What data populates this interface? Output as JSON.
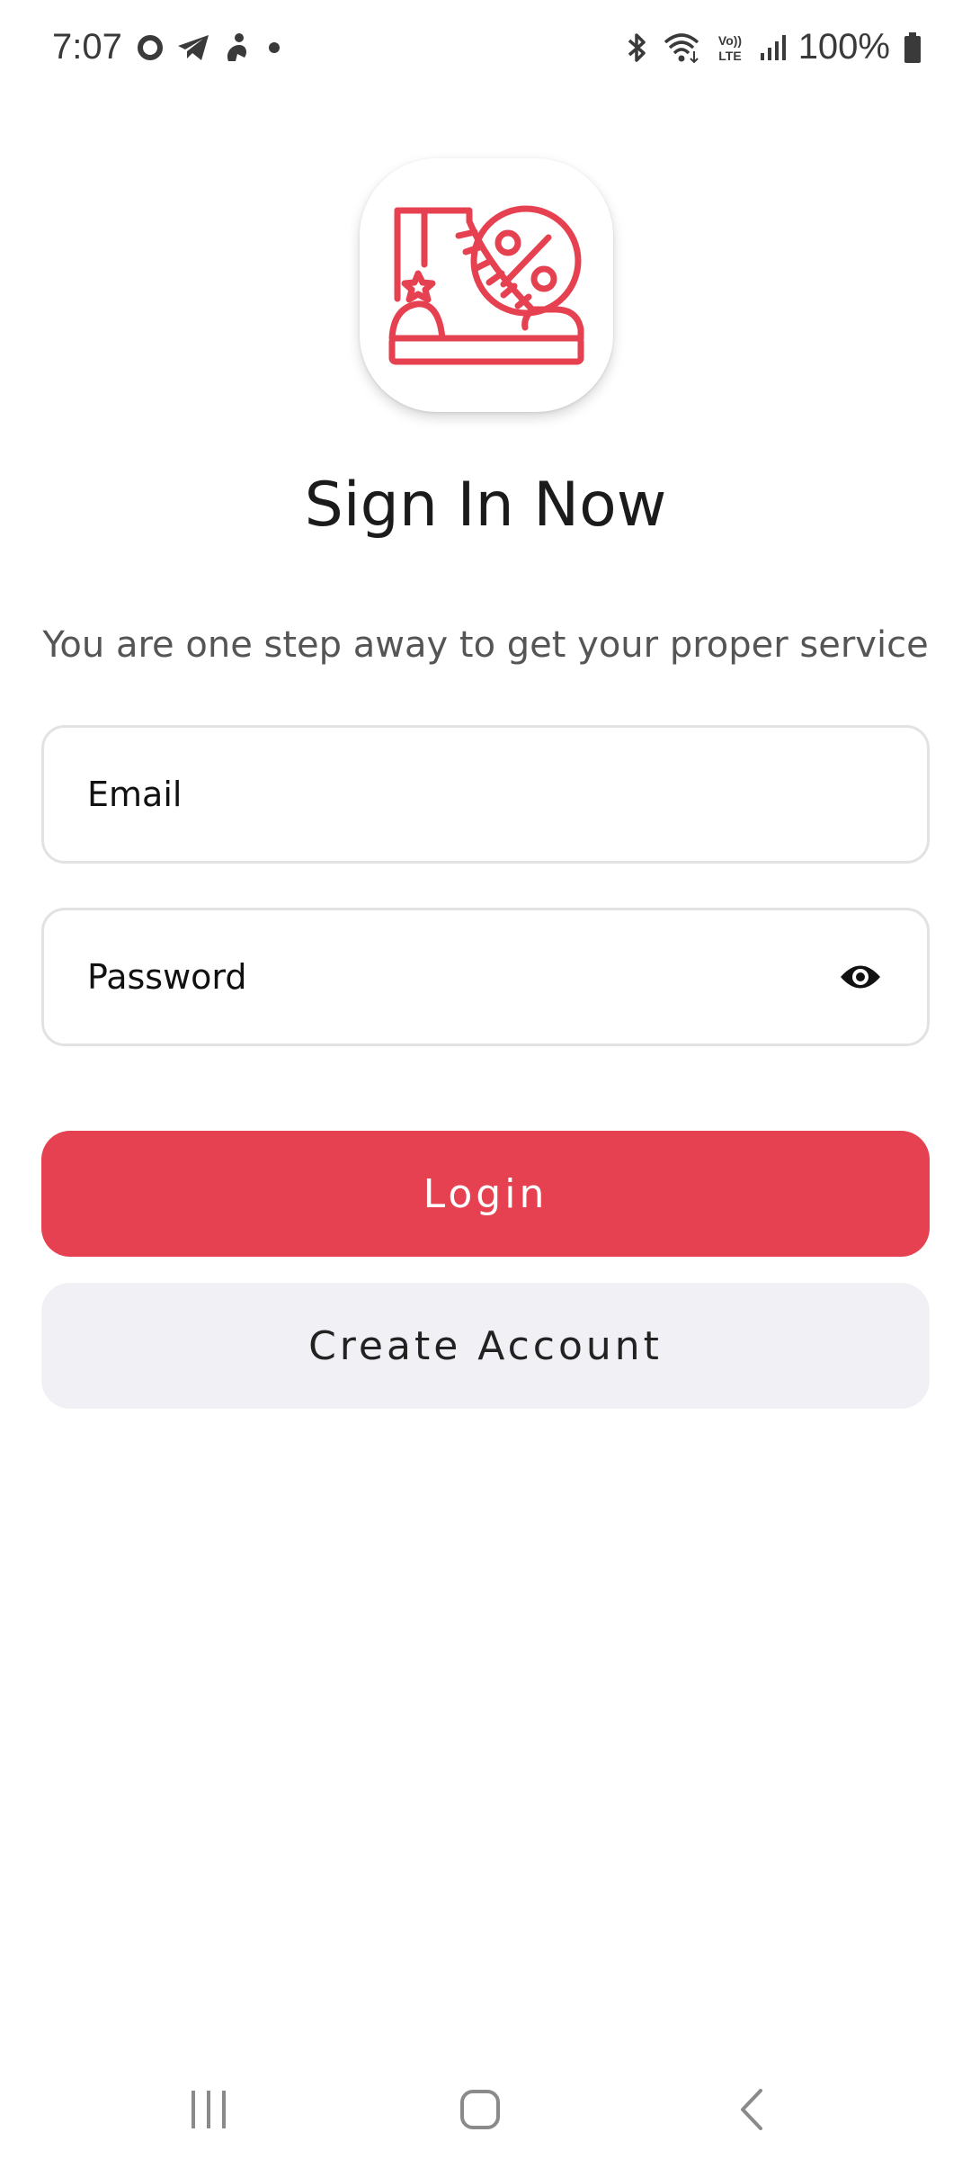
{
  "status_bar": {
    "time": "7:07",
    "battery": "100%",
    "left_icons": [
      "vodafone-icon",
      "telegram-icon",
      "notification-icon",
      "dot-icon"
    ],
    "right_icons": [
      "bluetooth-icon",
      "wifi-icon",
      "volte-icon",
      "signal-icon",
      "battery-icon"
    ],
    "volte_top": "Vo))",
    "volte_bottom": "LTE"
  },
  "logo": {
    "icon": "sneaker-discount-icon",
    "color": "#e64150"
  },
  "header": {
    "title": "Sign In Now",
    "subtitle": "You are one step away to get your proper service"
  },
  "form": {
    "email_placeholder": "Email",
    "email_value": "",
    "password_placeholder": "Password",
    "password_value": "",
    "password_toggle_icon": "eye-icon"
  },
  "buttons": {
    "login_label": "Login",
    "create_account_label": "Create Account",
    "accent_color": "#e64150",
    "secondary_bg": "#f1f0f5"
  },
  "nav_bar": {
    "items": [
      "recents-icon",
      "home-icon",
      "back-icon"
    ]
  }
}
